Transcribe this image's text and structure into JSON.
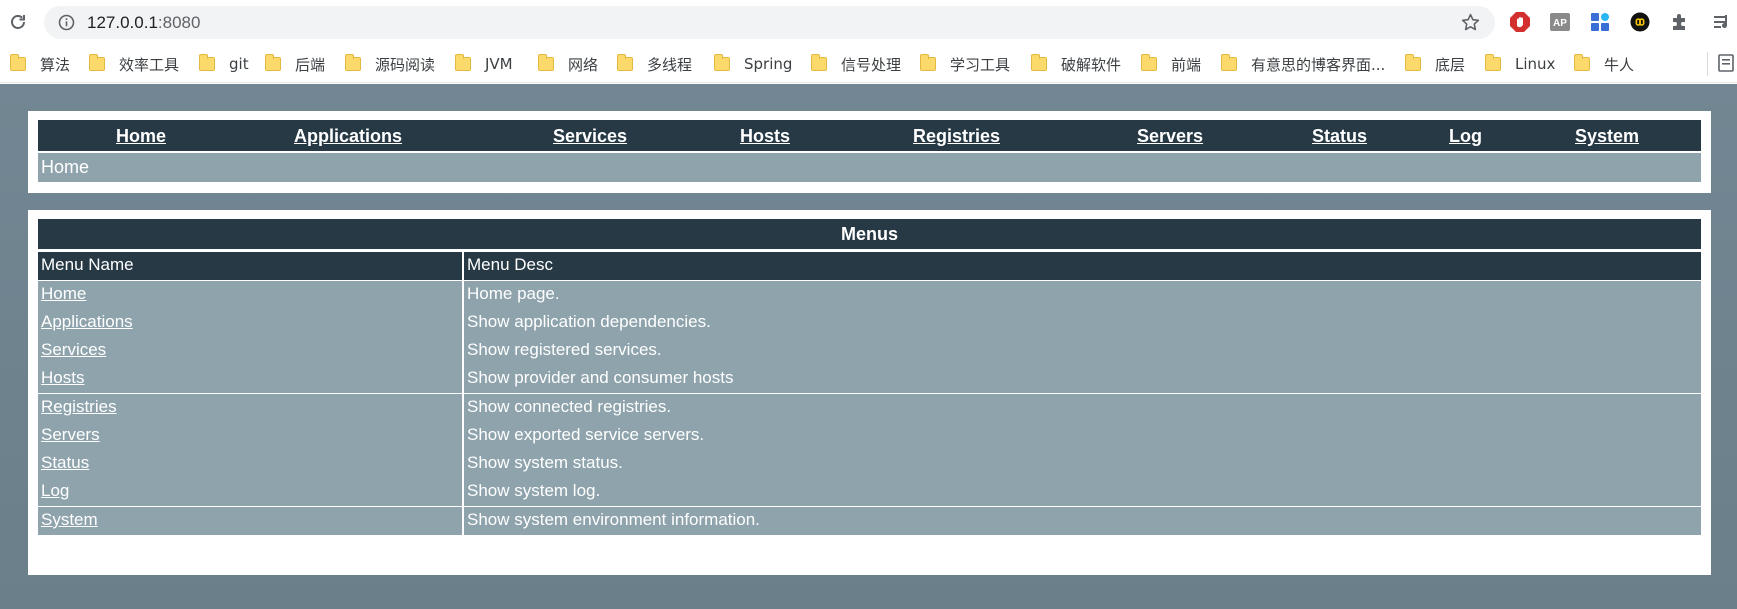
{
  "browser": {
    "url_host": "127.0.0.1",
    "url_port": ":8080"
  },
  "bookmarks": [
    "算法",
    "效率工具",
    "git",
    "后端",
    "源码阅读",
    "JVM",
    "网络",
    "多线程",
    "Spring",
    "信号处理",
    "学习工具",
    "破解软件",
    "前端",
    "有意思的博客界面...",
    "底层",
    "Linux",
    "牛人"
  ],
  "nav": {
    "items": [
      "Home",
      "Applications",
      "Services",
      "Hosts",
      "Registries",
      "Servers",
      "Status",
      "Log",
      "System"
    ],
    "breadcrumb": "Home"
  },
  "menus": {
    "title": "Menus",
    "columns": [
      "Menu Name",
      "Menu Desc"
    ],
    "rows": [
      {
        "name": "Home",
        "desc": "Home page."
      },
      {
        "name": "Applications",
        "desc": "Show application dependencies."
      },
      {
        "name": "Services",
        "desc": "Show registered services."
      },
      {
        "name": "Hosts",
        "desc": "Show provider and consumer hosts"
      },
      {
        "name": "Registries",
        "desc": "Show connected registries."
      },
      {
        "name": "Servers",
        "desc": "Show exported service servers."
      },
      {
        "name": "Status",
        "desc": "Show system status."
      },
      {
        "name": "Log",
        "desc": "Show system log."
      },
      {
        "name": "System",
        "desc": "Show system environment information."
      }
    ]
  },
  "colors": {
    "nav_bg": "#263945",
    "row_bg": "#8ea3ac",
    "page_bg": "#728793"
  }
}
